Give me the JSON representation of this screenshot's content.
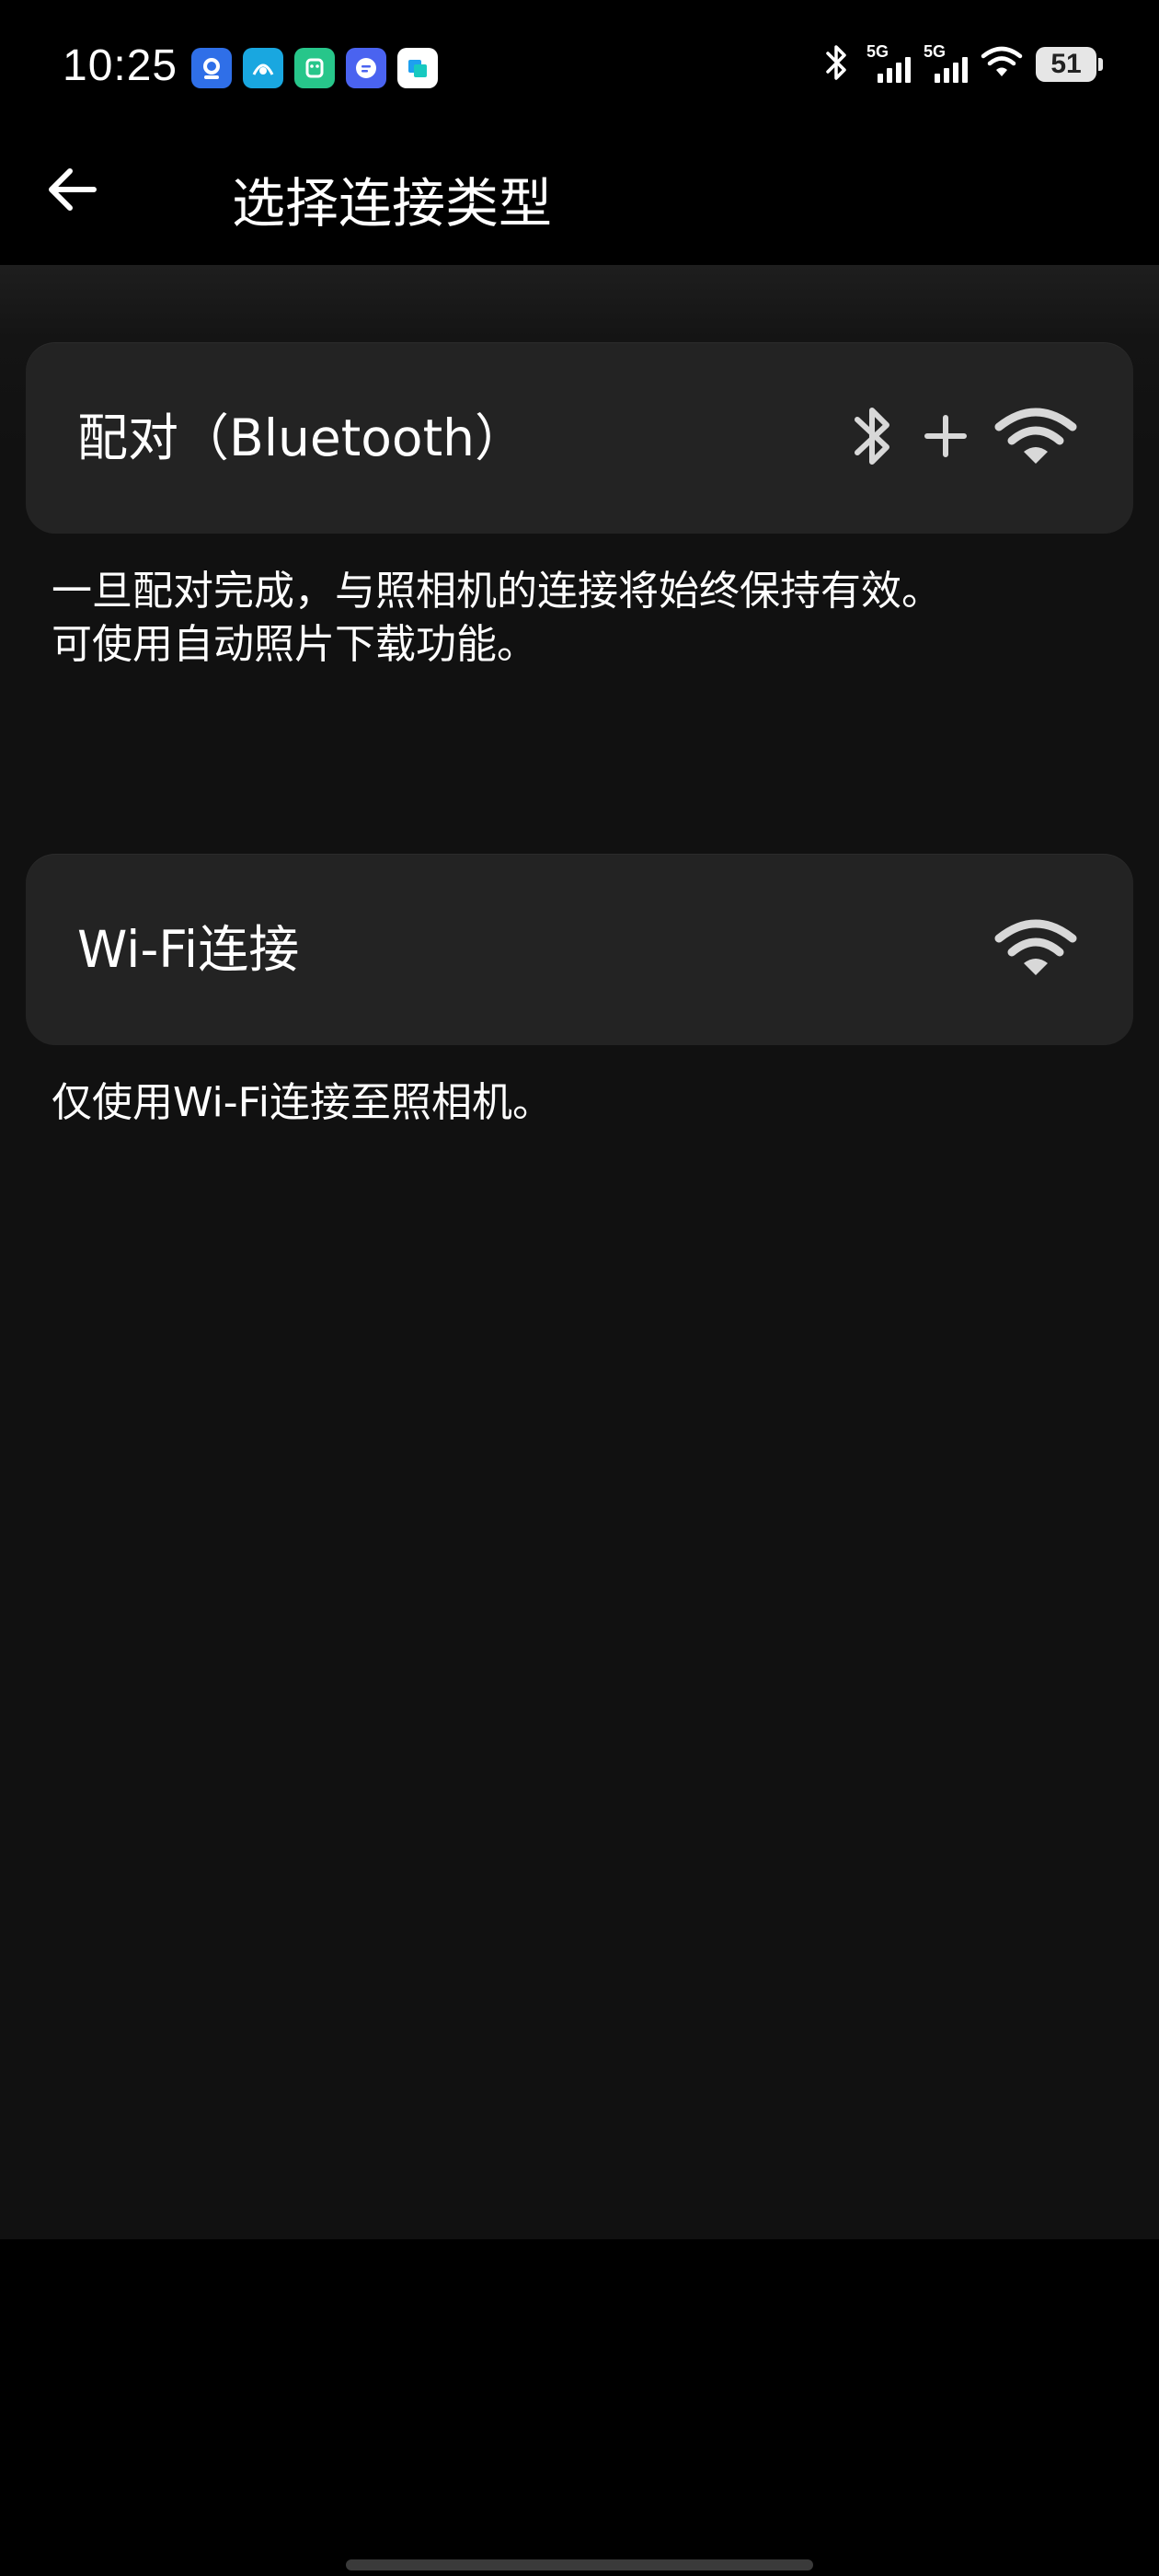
{
  "status_bar": {
    "time": "10:25",
    "notification_icons": [
      "app-icon-1",
      "app-icon-2",
      "app-icon-3",
      "app-icon-4",
      "app-icon-5"
    ],
    "network_1": "5G",
    "network_2": "5G",
    "battery": "51",
    "battery_level_percent": 51
  },
  "header": {
    "title": "选择连接类型"
  },
  "options": [
    {
      "label": "配对（Bluetooth）",
      "icons": [
        "bluetooth-icon",
        "plus-icon",
        "wifi-icon"
      ],
      "description": [
        "一旦配对完成，与照相机的连接将始终保持有效。",
        "可使用自动照片下载功能。"
      ]
    },
    {
      "label": "Wi-Fi连接",
      "icons": [
        "wifi-icon"
      ],
      "description": [
        "仅使用Wi-Fi连接至照相机。"
      ]
    }
  ],
  "colors": {
    "background": "#111111",
    "card": "#232323",
    "text": "#ffffff",
    "icon": "#d8d8d8"
  }
}
